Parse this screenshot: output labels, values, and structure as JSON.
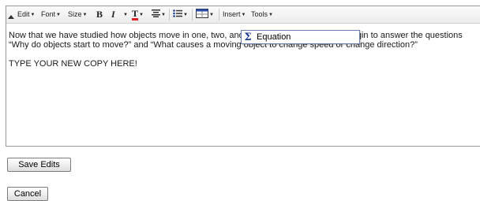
{
  "toolbar": {
    "edit_label": "Edit",
    "font_label": "Font",
    "size_label": "Size",
    "bold_label": "B",
    "italic_label": "I",
    "text_color_label": "T",
    "insert_label": "Insert",
    "tools_label": "Tools"
  },
  "content": {
    "paragraph_1": "Now that we have studied how objects move in one, two, and three dimensions, we can begin to answer the questions “Why do objects start to move?” and “What causes a moving object to change speed or change direction?”",
    "paragraph_2": "TYPE YOUR NEW COPY HERE!"
  },
  "insert_menu": {
    "items": [
      {
        "icon": "sigma-icon",
        "label": "Equation"
      }
    ]
  },
  "buttons": {
    "save_label": "Save Edits",
    "cancel_label": "Cancel"
  }
}
